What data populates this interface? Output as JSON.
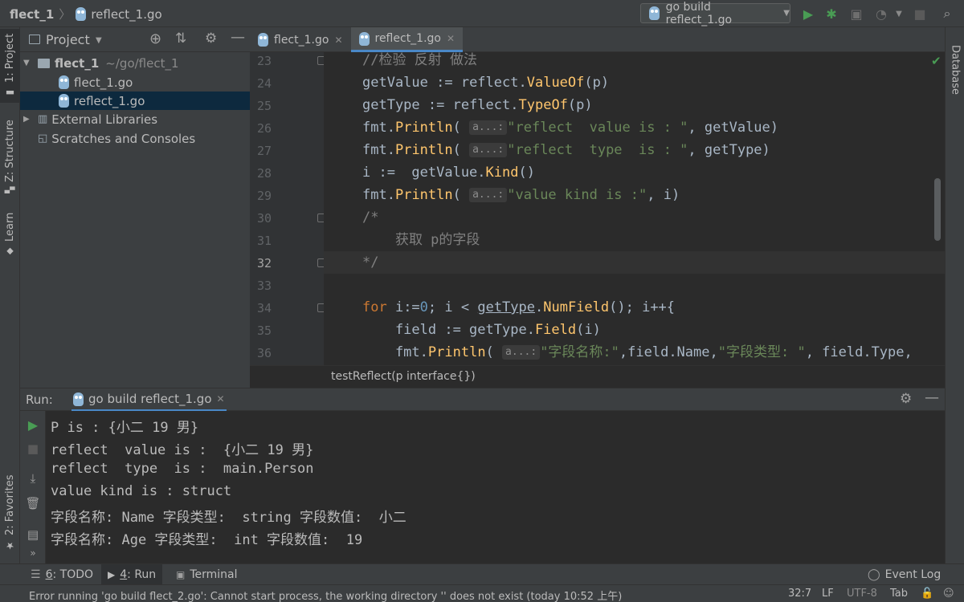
{
  "titlebar": {
    "project": "flect_1",
    "file": "reflect_1.go",
    "run_config": "go build reflect_1.go"
  },
  "left_tools": {
    "project": "1: Project",
    "structure": "Z: Structure",
    "learn": "Learn",
    "favorites": "2: Favorites"
  },
  "right_tools": {
    "database": "Database"
  },
  "project_panel": {
    "title": "Project",
    "tree": {
      "root_name": "flect_1",
      "root_path": "~/go/flect_1",
      "files": [
        "flect_1.go",
        "reflect_1.go"
      ],
      "external": "External Libraries",
      "scratches": "Scratches and Consoles"
    }
  },
  "editor": {
    "tabs": [
      {
        "label": "flect_1.go",
        "active": false
      },
      {
        "label": "reflect_1.go",
        "active": true
      }
    ],
    "line_numbers": [
      "23",
      "24",
      "25",
      "26",
      "27",
      "28",
      "29",
      "30",
      "31",
      "32",
      "33",
      "34",
      "35",
      "36"
    ],
    "current_line": "32",
    "hint": "a...:",
    "lines": {
      "l23": "//检验 反射 做法",
      "l24_var": "getValue := ",
      "l24_pkg": "reflect",
      "l24_fn": "ValueOf",
      "l24_rest": "(p)",
      "l25_var": "getType := ",
      "l25_pkg": "reflect",
      "l25_fn": "TypeOf",
      "l25_rest": "(p)",
      "l26_pkg": "fmt",
      "l26_fn": "Println",
      "l26_str": "\"reflect  value is : \"",
      "l26_rest": ", getValue)",
      "l27_pkg": "fmt",
      "l27_fn": "Println",
      "l27_str": "\"reflect  type  is : \"",
      "l27_rest": ", getType)",
      "l28_var": "i :=  getValue.",
      "l28_fn": "Kind",
      "l28_rest": "()",
      "l29_pkg": "fmt",
      "l29_fn": "Println",
      "l29_str": "\"value kind is :\"",
      "l29_rest": ", i)",
      "l30": "/*",
      "l31": "    获取 p的字段",
      "l32": "*/",
      "l34_kw": "for",
      "l34_a": " i:=",
      "l34_num": "0",
      "l34_b": "; i < ",
      "l34_fn1": "getType",
      "l34_c": ".",
      "l34_fn2": "NumField",
      "l34_d": "(); i++{",
      "l35_var": "    field := getType.",
      "l35_fn": "Field",
      "l35_rest": "(i)",
      "l36_pkg": "    fmt",
      "l36_fn": "Println",
      "l36_str1": "\"字段名称:\"",
      "l36_mid": ",field.Name,",
      "l36_str2": "\"字段类型: \"",
      "l36_rest": ", field.Type,"
    },
    "breadcrumb": "testReflect(p interface{})"
  },
  "run_panel": {
    "label": "Run:",
    "tab": "go build reflect_1.go",
    "output": [
      "P is : {小二 19 男}",
      "reflect  value is :  {小二 19 男}",
      "reflect  type  is :  main.Person",
      "value kind is : struct",
      "字段名称: Name 字段类型:  string 字段数值:  小二",
      "字段名称: Age 字段类型:  int 字段数值:  19"
    ]
  },
  "bottom_tabs": {
    "todo_num": "6",
    "todo": ": TODO",
    "run_num": "4",
    "run": ": Run",
    "terminal": "Terminal",
    "event_log": "Event Log"
  },
  "status": {
    "message": "Error running 'go build flect_2.go': Cannot start process, the working directory '' does not exist (today 10:52 上午)",
    "position": "32:7",
    "line_sep": "LF",
    "encoding": "UTF-8",
    "indent": "Tab"
  },
  "colors": {
    "bg": "#2b2b2b",
    "panel": "#3c3f41",
    "keyword": "#cc7832",
    "function": "#ffc66d",
    "string": "#6a8759",
    "comment": "#808080",
    "run_green": "#499c54",
    "selection": "#0d293e"
  }
}
